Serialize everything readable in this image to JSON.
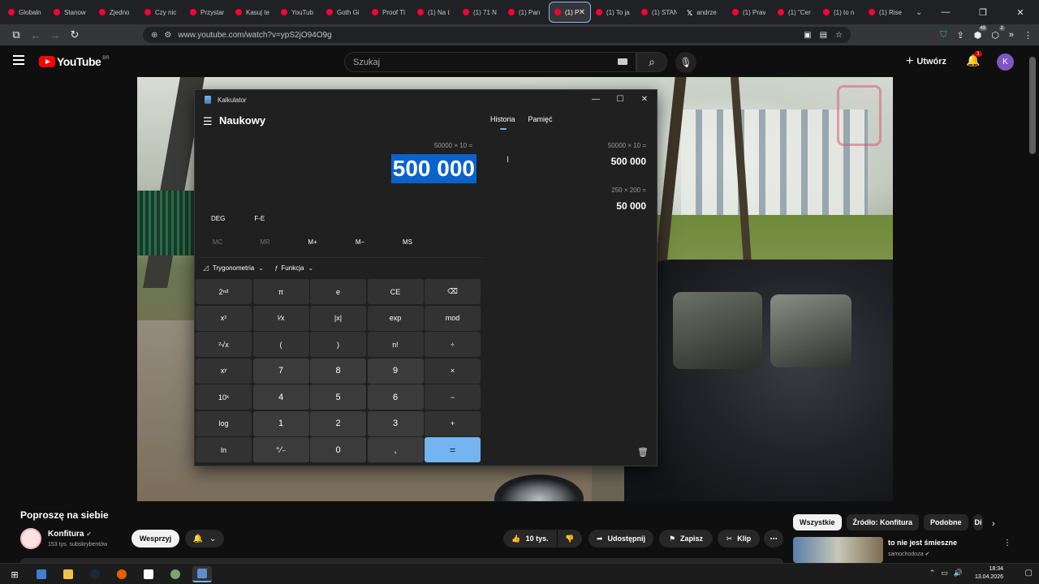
{
  "browser": {
    "tabs": [
      {
        "label": "Globaln",
        "icon": "youtube-icon"
      },
      {
        "label": "Stanow",
        "icon": "youtube-icon"
      },
      {
        "label": "Zjedno",
        "icon": "youtube-icon"
      },
      {
        "label": "Czy nic",
        "icon": "youtube-icon"
      },
      {
        "label": "Przystar",
        "icon": "youtube-icon"
      },
      {
        "label": "Kasuj te",
        "icon": "youtube-icon"
      },
      {
        "label": "YouTub",
        "icon": "youtube-icon"
      },
      {
        "label": "Goth Gi",
        "icon": "youtube-icon"
      },
      {
        "label": "Proof Tl",
        "icon": "youtube-icon"
      },
      {
        "label": "(1) Na t",
        "icon": "youtube-icon"
      },
      {
        "label": "(1) 71 N",
        "icon": "youtube-icon"
      },
      {
        "label": "(1) Pan",
        "icon": "youtube-icon"
      },
      {
        "label": "(1) P",
        "icon": "youtube-icon",
        "active": true
      },
      {
        "label": "(1) To ja",
        "icon": "youtube-icon"
      },
      {
        "label": "(1) STAN",
        "icon": "youtube-icon"
      },
      {
        "label": "andrze",
        "icon": "x-icon"
      },
      {
        "label": "(1) Prav",
        "icon": "youtube-icon"
      },
      {
        "label": "(1) \"Cer",
        "icon": "youtube-icon"
      },
      {
        "label": "(1) to n",
        "icon": "youtube-icon"
      },
      {
        "label": "(1) Rise",
        "icon": "youtube-icon"
      }
    ],
    "url": "www.youtube.com/watch?v=ypS2jO94O9g",
    "ext_badges": {
      "a": "49",
      "b": "2"
    }
  },
  "youtube": {
    "logo_text": "YouTube",
    "country_code": "BR",
    "search_placeholder": "Szukaj",
    "create_label": "Utwórz",
    "notifications_count": "1",
    "avatar_letter": "K"
  },
  "calculator": {
    "window_title": "Kalkulator",
    "mode": "Naukowy",
    "expression": "50000 × 10 =",
    "result": "500 000",
    "angle_unit": "DEG",
    "fe_label": "F-E",
    "memory": [
      "MC",
      "MR",
      "M+",
      "M−",
      "MS"
    ],
    "trig_label": "Trygonometria",
    "func_label": "Funkcja",
    "keys": [
      [
        "2ⁿᵈ",
        "π",
        "e",
        "CE",
        "⌫"
      ],
      [
        "x²",
        "¹⁄x",
        "|x|",
        "exp",
        "mod"
      ],
      [
        "²√x",
        "(",
        ")",
        "n!",
        "÷"
      ],
      [
        "xʸ",
        "7",
        "8",
        "9",
        "×"
      ],
      [
        "10ˣ",
        "4",
        "5",
        "6",
        "−"
      ],
      [
        "log",
        "1",
        "2",
        "3",
        "+"
      ],
      [
        "ln",
        "⁺⁄₋",
        "0",
        ",",
        "="
      ]
    ],
    "tabs": {
      "history": "Historia",
      "memory": "Pamięć"
    },
    "history": [
      {
        "expression": "50000   ×   10 =",
        "result": "500 000"
      },
      {
        "expression": "250   ×   200 =",
        "result": "50 000"
      }
    ]
  },
  "video": {
    "title": "Poproszę na siebie",
    "channel": "Konfitura",
    "subscribers": "153 tys. subskrybentów",
    "support_label": "Wesprzyj",
    "likes": "10 tys.",
    "share_label": "Udostępnij",
    "save_label": "Zapisz",
    "clip_label": "Klip"
  },
  "sidebar": {
    "chips": [
      "Wszystkie",
      "Źródło: Konfitura",
      "Podobne",
      "Di"
    ],
    "recommendation": {
      "title": "to nie jest śmieszne",
      "channel": "samochodoza"
    }
  },
  "taskbar": {
    "time": "18:34",
    "date": "13.04.2026"
  },
  "colors": {
    "accent_blue": "#74b4f0",
    "selection_blue": "#0a63c9",
    "youtube_red": "#ff0000"
  }
}
